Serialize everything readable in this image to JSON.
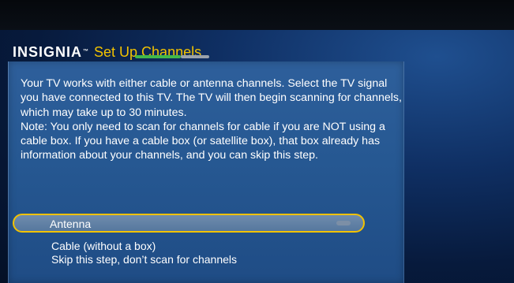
{
  "header": {
    "brand": "INSIGNIA",
    "brand_mark": "™",
    "title": "Set Up Channels"
  },
  "description": {
    "line1": "Your TV works with either cable or antenna channels. Select the TV signal you have connected to this TV. The TV will then begin scanning for channels, which may take up to 30 minutes.",
    "line2": "Note: You only need to scan for channels for cable if you are NOT using a cable box. If you have a cable box (or satellite box), that box already has information about your channels, and you can skip this step."
  },
  "options": {
    "selected": "Antenna",
    "items": [
      "Cable (without a box)",
      "Skip this step, don’t scan for channels"
    ]
  },
  "colors": {
    "accent": "#f2c200",
    "progress_green": "#41b84a",
    "progress_gray": "#9aa2ab"
  }
}
